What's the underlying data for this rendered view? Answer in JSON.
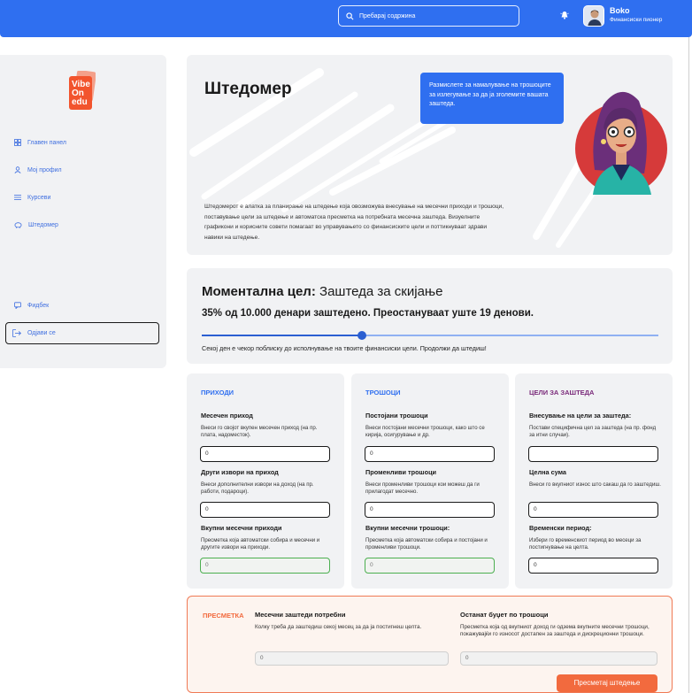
{
  "header": {
    "search_placeholder": "Пребарај содржина",
    "user_name": "Boko",
    "user_role": "Финансиски пионер"
  },
  "sidebar": {
    "logo_lines": [
      "Vibe",
      "On",
      "edu"
    ],
    "items": [
      {
        "label": "Главен панел",
        "icon": "dashboard-icon"
      },
      {
        "label": "Мој профил",
        "icon": "user-icon"
      },
      {
        "label": "Курсеви",
        "icon": "list-icon"
      },
      {
        "label": "Штедомер",
        "icon": "piggy-bank-icon"
      }
    ],
    "feedback": "Фидбек",
    "logout": "Одјави се"
  },
  "hero": {
    "title": "Штедомер",
    "tip": "Размислете за намалување на трошоците за излегување за да ја зголемите вашата заштеда.",
    "description": "Штедомерот е алатка за планирање на штедење која овозможува внесување на месечни приходи и трошоци, поставување цели за штедење и автоматска пресметка на потребната месечна заштеда. Визуелните графикони и корисните совети помагаат во управувањето со финансиските цели и поттикнуваат здрави навики на штедење."
  },
  "goal": {
    "title_bold": "Моментална цел:",
    "title_rest": " Заштеда за скијање",
    "status": "35% од 10.000 денари заштедено. Преостануваат уште 19 денови.",
    "progress": 0.35,
    "note": "Секој ден е чекор поблиску до исполнување на твоите финансиски цели. Продолжи да штедиш!"
  },
  "colors": {
    "primary": "#2f6ff0",
    "income_head": "#2f6ff0",
    "costs_head": "#2f6ff0",
    "goals_head": "#7a2a7a",
    "accent": "#f26a3e"
  },
  "income": {
    "heading": "ПРИХОДИ",
    "f1_label": "Месечен приход",
    "f1_help": "Внеси го својот вкупен месечен приход (на пр. плата, надоместок).",
    "f1_value": "0",
    "f2_label": "Други извори на приход",
    "f2_help": "Внеси дополнителни извори на доход (на пр. работи, подароци).",
    "f2_value": "0",
    "f3_label": "Вкупни месечни приходи",
    "f3_help": "Пресметка која автоматски собира и месечни и другите извори на приходи.",
    "f3_value": "0"
  },
  "costs": {
    "heading": "ТРОШОЦИ",
    "f1_label": "Постојани трошоци",
    "f1_help": "Внеси постојани месечни трошоци, како што се кирија, осигурување и др.",
    "f1_value": "0",
    "f2_label": "Променливи трошоци",
    "f2_help": "Внеси променливи трошоци кои можеш да ги прилагодат месечно.",
    "f2_value": "0",
    "f3_label": "Вкупни месечни трошоци:",
    "f3_help": "Пресметка која автоматски собира и постојани и променливи трошоци.",
    "f3_value": "0"
  },
  "goals": {
    "heading": "ЦЕЛИ ЗА ЗАШТЕДА",
    "f1_label": "Внесување на цели за заштеда:",
    "f1_help": "Постави специфична цел за заштеда (на пр. фонд за итни случаи).",
    "f1_value": "",
    "f2_label": "Целна сума",
    "f2_help": "Внеси го вкупниот износ што сакаш да го заштедиш.",
    "f2_value": "0",
    "f3_label": "Временски период:",
    "f3_help": "Избери го временскиот период во месеци за постигнување на целта.",
    "f3_value": "0"
  },
  "calc": {
    "tag": "ПРЕСМЕТКА",
    "left_label": "Месечни заштеди потребни",
    "left_help": "Колку треба да заштедиш секој месец за да ја постигнеш целта.",
    "left_value": "0",
    "right_label": "Останат буџет по трошоци",
    "right_help": "Пресметка која од вкупниот доход ги одзема вкупните месечни трошоци, покажувајќи го износот достапен за заштеда и дискреционни трошоци.",
    "right_value": "0",
    "button": "Пресметај штедење"
  }
}
